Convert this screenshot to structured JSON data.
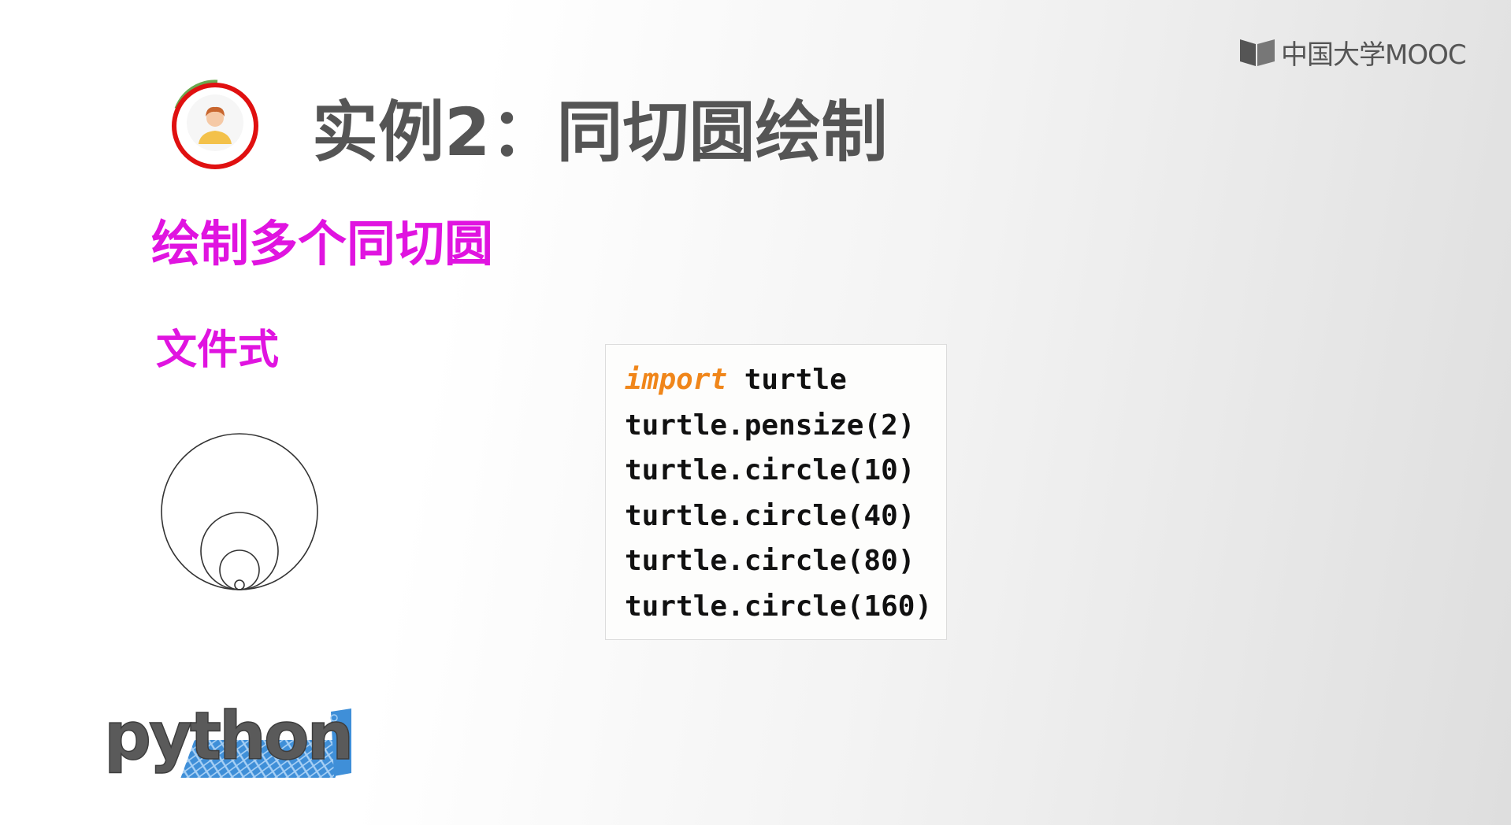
{
  "brand": {
    "logo_text": "中国大学MOOC"
  },
  "slide": {
    "title": "实例2：同切圆绘制",
    "subtitle": "绘制多个同切圆",
    "mode_label": "文件式"
  },
  "code": {
    "lines": [
      {
        "keyword": "import",
        "rest": " turtle"
      },
      {
        "keyword": "",
        "rest": "turtle.pensize(2)"
      },
      {
        "keyword": "",
        "rest": "turtle.circle(10)"
      },
      {
        "keyword": "",
        "rest": "turtle.circle(40)"
      },
      {
        "keyword": "",
        "rest": "turtle.circle(80)"
      },
      {
        "keyword": "",
        "rest": "turtle.circle(160)"
      }
    ]
  },
  "python_logo": {
    "text": "python"
  },
  "colors": {
    "title": "#555555",
    "accent_magenta": "#e014e0",
    "keyword_orange": "#f0861a",
    "avatar_ring": "#e01010"
  }
}
